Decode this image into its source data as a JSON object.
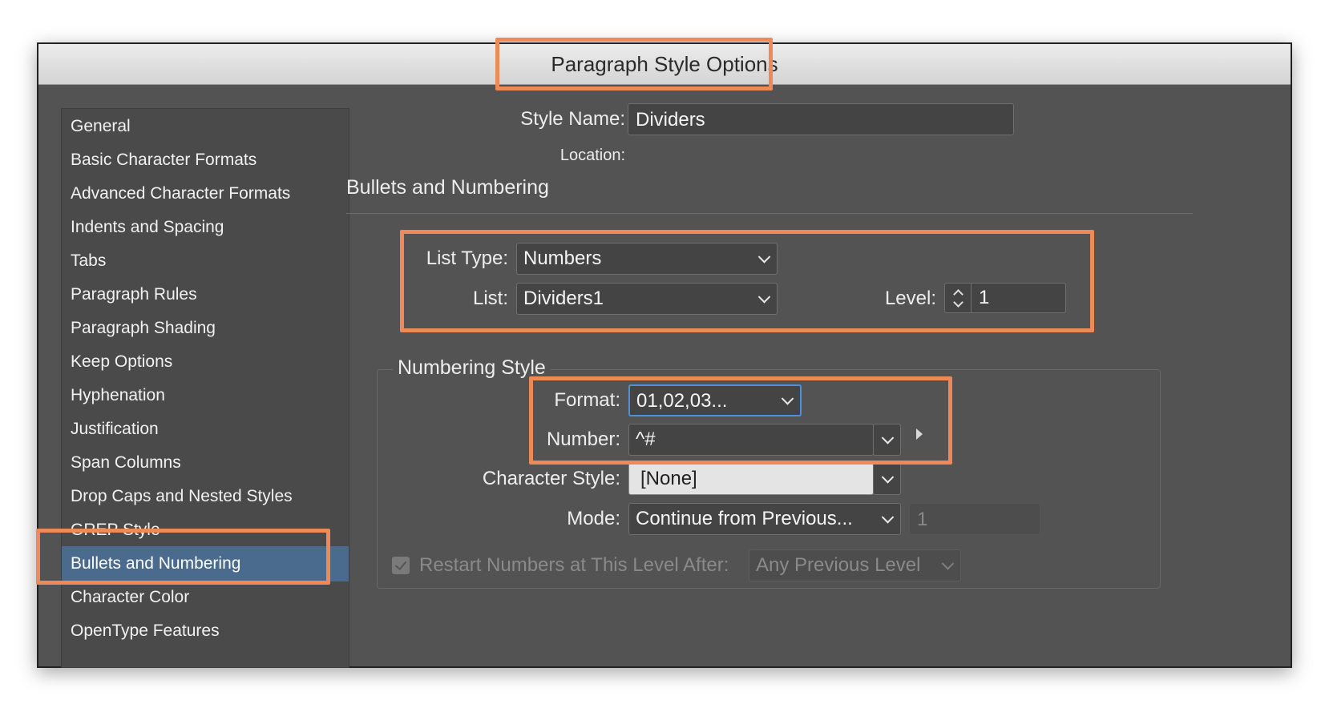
{
  "window": {
    "title": "Paragraph Style Options"
  },
  "sidebar": {
    "items": [
      {
        "label": "General"
      },
      {
        "label": "Basic Character Formats"
      },
      {
        "label": "Advanced Character Formats"
      },
      {
        "label": "Indents and Spacing"
      },
      {
        "label": "Tabs"
      },
      {
        "label": "Paragraph Rules"
      },
      {
        "label": "Paragraph Shading"
      },
      {
        "label": "Keep Options"
      },
      {
        "label": "Hyphenation"
      },
      {
        "label": "Justification"
      },
      {
        "label": "Span Columns"
      },
      {
        "label": "Drop Caps and Nested Styles"
      },
      {
        "label": "GREP Style"
      },
      {
        "label": "Bullets and Numbering",
        "active": true
      },
      {
        "label": "Character Color"
      },
      {
        "label": "OpenType Features"
      }
    ]
  },
  "main": {
    "style_name_label": "Style Name:",
    "style_name_value": "Dividers",
    "location_label": "Location:",
    "section_title": "Bullets and Numbering",
    "list_type_label": "List Type:",
    "list_type_value": "Numbers",
    "list_label": "List:",
    "list_value": "Dividers1",
    "level_label": "Level:",
    "level_value": "1",
    "numbering_style_title": "Numbering Style",
    "format_label": "Format:",
    "format_value": "01,02,03...",
    "number_label": "Number:",
    "number_value": "^#",
    "char_style_label": "Character Style:",
    "char_style_value": "[None]",
    "mode_label": "Mode:",
    "mode_value": "Continue from Previous...",
    "mode_number_value": "1",
    "restart_label": "Restart Numbers at This Level After:",
    "restart_checked": true,
    "restart_value": "Any Previous Level"
  },
  "colors": {
    "highlight": "#ee8a57",
    "panel": "#535353",
    "active_item": "#4a6b8e",
    "focus_ring": "#4f8fd8"
  }
}
